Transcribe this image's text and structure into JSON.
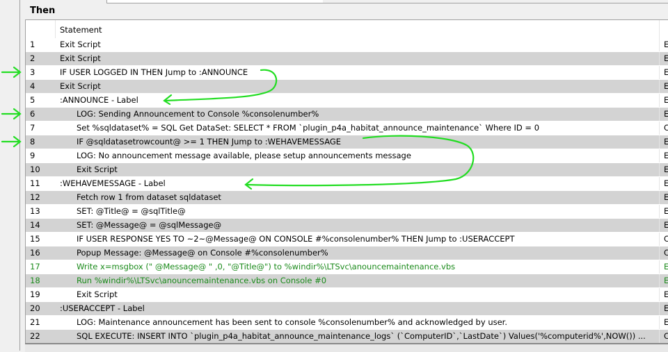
{
  "section_title": "Then",
  "table": {
    "headers": [
      "",
      "Statement",
      ""
    ],
    "rows": [
      {
        "n": "1",
        "stmt": "Exit Script",
        "indent": 0,
        "c": "E",
        "green": false
      },
      {
        "n": "2",
        "stmt": "Exit Script",
        "indent": 0,
        "c": "E",
        "green": false
      },
      {
        "n": "3",
        "stmt": "IF USER LOGGED IN   THEN  Jump to :ANNOUNCE",
        "indent": 0,
        "c": "E",
        "green": false
      },
      {
        "n": "4",
        "stmt": "Exit Script",
        "indent": 0,
        "c": "E",
        "green": false
      },
      {
        "n": "5",
        "stmt": ":ANNOUNCE - Label",
        "indent": 0,
        "c": "E",
        "green": false
      },
      {
        "n": "6",
        "stmt": "LOG:  Sending Announcement to Console %consolenumber%",
        "indent": 1,
        "c": "E",
        "green": false
      },
      {
        "n": "7",
        "stmt": "Set %sqldataset% = SQL Get DataSet:  SELECT *  FROM `plugin_p4a_habitat_announce_maintenance` Where ID = 0",
        "indent": 1,
        "c": "C",
        "green": false
      },
      {
        "n": "8",
        "stmt": "IF  @sqldatasetrowcount@  >=  1  THEN  Jump to :WEHAVEMESSAGE",
        "indent": 1,
        "c": "E",
        "green": false
      },
      {
        "n": "9",
        "stmt": "LOG:  No announcement message available, please setup announcements message",
        "indent": 1,
        "c": "E",
        "green": false
      },
      {
        "n": "10",
        "stmt": "Exit Script",
        "indent": 1,
        "c": "E",
        "green": false
      },
      {
        "n": "11",
        "stmt": ":WEHAVEMESSAGE - Label",
        "indent": 0,
        "c": "E",
        "green": false
      },
      {
        "n": "12",
        "stmt": "Fetch row 1 from dataset sqldataset",
        "indent": 1,
        "c": "E",
        "green": false
      },
      {
        "n": "13",
        "stmt": "SET:  @Title@ = @sqlTitle@",
        "indent": 1,
        "c": "E",
        "green": false
      },
      {
        "n": "14",
        "stmt": "SET:  @Message@ = @sqlMessage@",
        "indent": 1,
        "c": "E",
        "green": false
      },
      {
        "n": "15",
        "stmt": "IF USER RESPONSE YES TO ~2~@Message@ ON CONSOLE #%consolenumber%  THEN  Jump to :USERACCEPT",
        "indent": 1,
        "c": "C",
        "green": false
      },
      {
        "n": "16",
        "stmt": "Popup Message: @Message@ on Console #%consolenumber%",
        "indent": 1,
        "c": "C",
        "green": false
      },
      {
        "n": "17",
        "stmt": "Write  x=msgbox (\" @Message@ \" ,0, \"@Title@\")  to  %windir%\\LTSvc\\anouncemaintenance.vbs",
        "indent": 1,
        "c": "E",
        "green": true
      },
      {
        "n": "18",
        "stmt": "Run %windir%\\LTSvc\\anouncemaintenance.vbs  on Console #0",
        "indent": 1,
        "c": "E",
        "green": true
      },
      {
        "n": "19",
        "stmt": "Exit Script",
        "indent": 1,
        "c": "E",
        "green": false
      },
      {
        "n": "20",
        "stmt": ":USERACCEPT - Label",
        "indent": 0,
        "c": "E",
        "green": false
      },
      {
        "n": "21",
        "stmt": "LOG:  Maintenance announcement has been sent to console %consolenumber% and acknowledged by user.",
        "indent": 1,
        "c": "E",
        "green": false
      },
      {
        "n": "22",
        "stmt": "SQL EXECUTE: INSERT INTO `plugin_p4a_habitat_announce_maintenance_logs` (`ComputerID`,`LastDate`) Values('%computerid%',NOW()) ...",
        "indent": 1,
        "c": "C",
        "green": false
      }
    ]
  },
  "annotation_color": "#22dd22",
  "annotated_rows": [
    "3",
    "6",
    "8"
  ]
}
